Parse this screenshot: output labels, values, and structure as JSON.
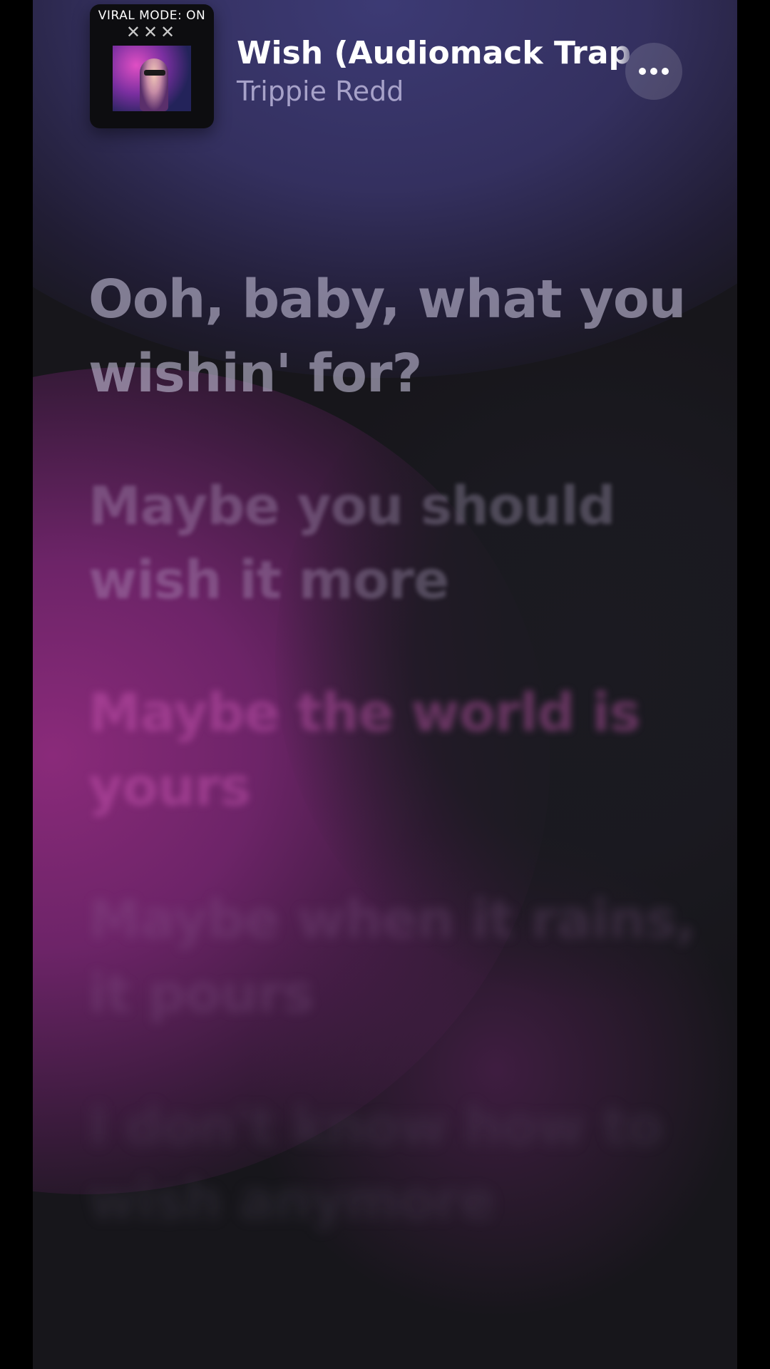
{
  "now_playing": {
    "album_art": {
      "banner_text": "VIRAL MODE: ON",
      "marks": "✕✕✕"
    },
    "title": "Wish (Audiomack Trap Symphony)",
    "artist": "Trippie Redd",
    "more_icon": "ellipsis-icon"
  },
  "lyrics": [
    {
      "text": "Ooh, baby, what you wishin' for?",
      "state": "current"
    },
    {
      "text": "Maybe you should wish it more",
      "state": "upcoming"
    },
    {
      "text": "Maybe the world is yours",
      "state": "upcoming"
    },
    {
      "text": "Maybe when it rains, it pours",
      "state": "upcoming"
    },
    {
      "text": "I don't know how to wish anymore",
      "state": "upcoming"
    }
  ],
  "colors": {
    "background": "#17161b",
    "accent_purple": "#3c3a74",
    "accent_pink": "#8a2a7a",
    "artist_text": "#a7a2c9"
  }
}
